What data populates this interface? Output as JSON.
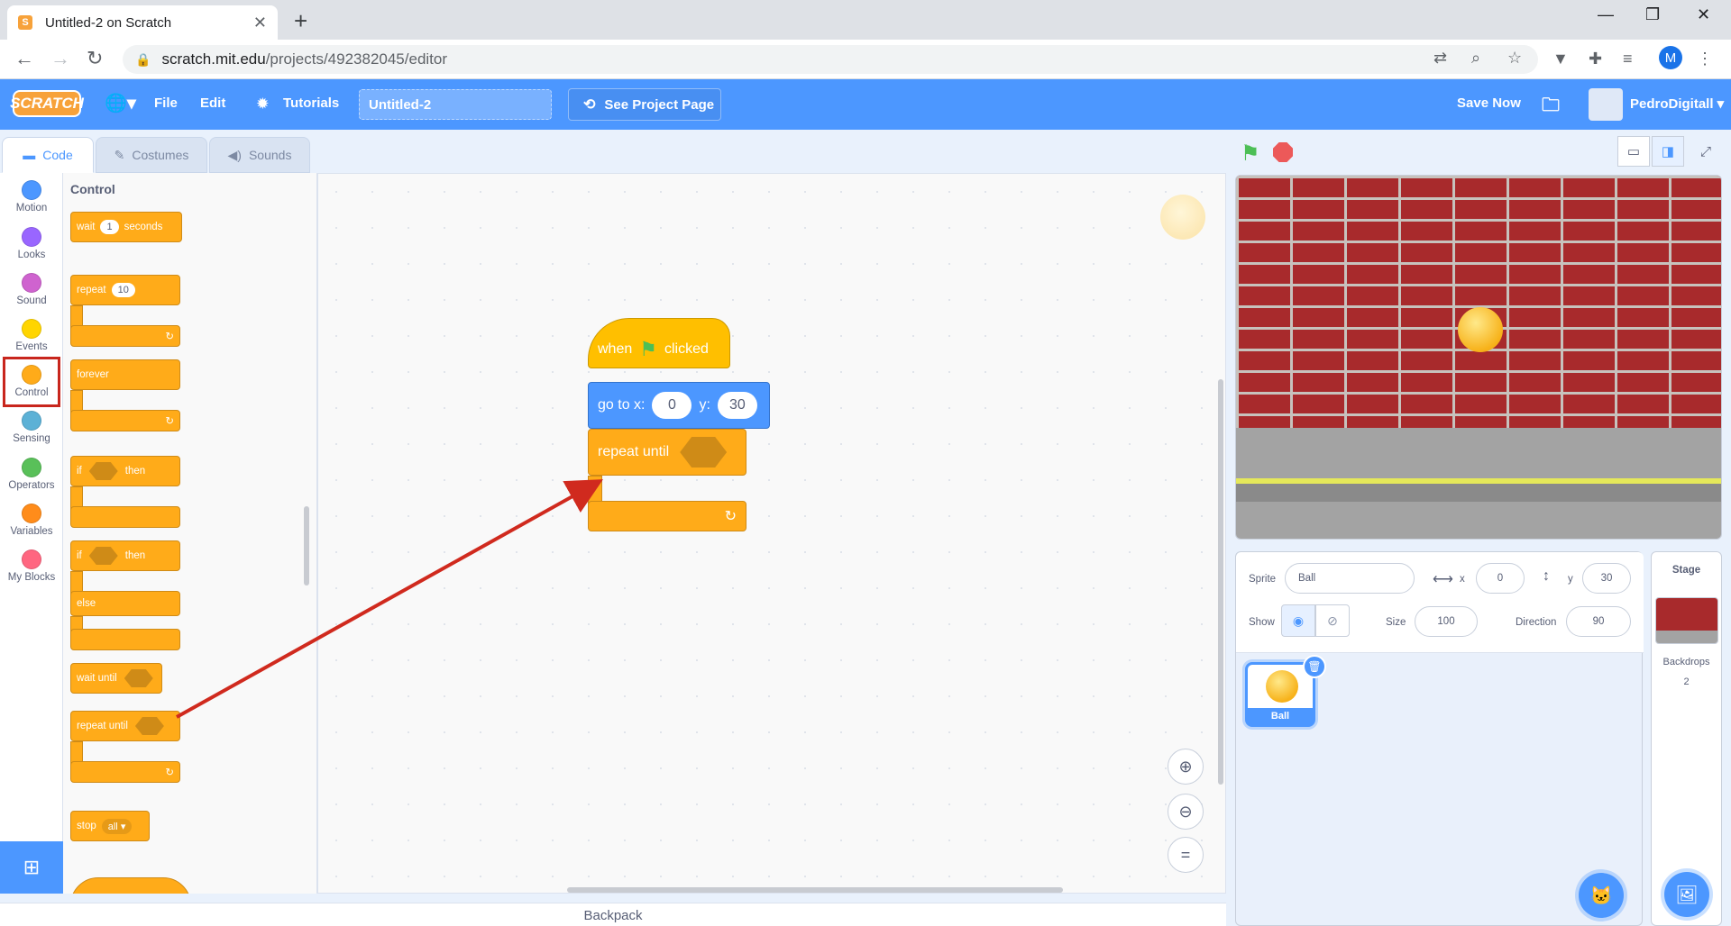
{
  "browser": {
    "tab_title": "Untitled-2 on Scratch",
    "url_domain": "scratch.mit.edu",
    "url_path": "/projects/492382045/editor",
    "profile_initial": "M"
  },
  "menubar": {
    "logo": "SCRATCH",
    "file": "File",
    "edit": "Edit",
    "tutorials": "Tutorials",
    "project_title": "Untitled-2",
    "see_project_page": "See Project Page",
    "save_now": "Save Now",
    "username": "PedroDigitall"
  },
  "editor_tabs": {
    "code": "Code",
    "costumes": "Costumes",
    "sounds": "Sounds"
  },
  "categories": [
    {
      "label": "Motion",
      "color": "#4c97ff"
    },
    {
      "label": "Looks",
      "color": "#9966ff"
    },
    {
      "label": "Sound",
      "color": "#cf63cf"
    },
    {
      "label": "Events",
      "color": "#ffd500"
    },
    {
      "label": "Control",
      "color": "#ffab19"
    },
    {
      "label": "Sensing",
      "color": "#5cb1d6"
    },
    {
      "label": "Operators",
      "color": "#59c059"
    },
    {
      "label": "Variables",
      "color": "#ff8c1a"
    },
    {
      "label": "My Blocks",
      "color": "#ff6680"
    }
  ],
  "palette": {
    "title": "Control",
    "wait": {
      "label": "wait",
      "value": "1",
      "suffix": "seconds"
    },
    "repeat": {
      "label": "repeat",
      "value": "10"
    },
    "forever": "forever",
    "if_then": {
      "if": "if",
      "then": "then"
    },
    "if_else": {
      "if": "if",
      "then": "then",
      "else": "else"
    },
    "wait_until": "wait until",
    "repeat_until": "repeat until",
    "stop": {
      "label": "stop",
      "value": "all"
    }
  },
  "script": {
    "hat": {
      "when": "when",
      "clicked": "clicked"
    },
    "goto": {
      "label": "go to x:",
      "x": "0",
      "ylabel": "y:",
      "y": "30"
    },
    "repeat_until": "repeat until"
  },
  "backpack": "Backpack",
  "sprite_info": {
    "sprite_label": "Sprite",
    "sprite_name": "Ball",
    "x_label": "x",
    "x_value": "0",
    "y_label": "y",
    "y_value": "30",
    "show_label": "Show",
    "size_label": "Size",
    "size_value": "100",
    "direction_label": "Direction",
    "direction_value": "90"
  },
  "sprites": [
    {
      "name": "Ball"
    }
  ],
  "stage_panel": {
    "title": "Stage",
    "backdrops_label": "Backdrops",
    "backdrops_count": "2"
  },
  "colors": {
    "accent": "#4c97ff",
    "control": "#ffab19",
    "motion": "#4c97ff",
    "events": "#ffbf00",
    "annotation": "#d02a1e"
  }
}
